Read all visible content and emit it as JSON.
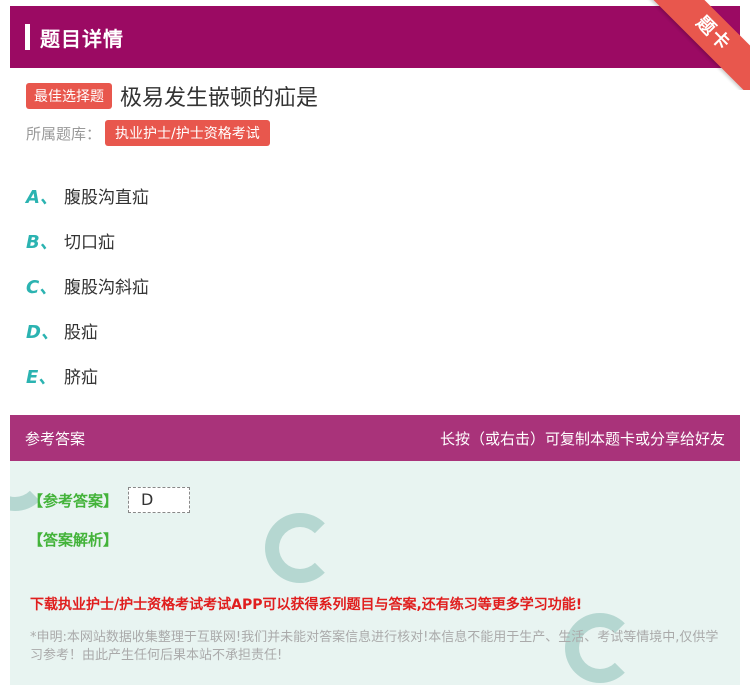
{
  "header": {
    "title": "题目详情",
    "ribbon": "题卡"
  },
  "question": {
    "badge": "最佳选择题",
    "text": "极易发生嵌顿的疝是"
  },
  "bank": {
    "label": "所属题库：",
    "tag": "执业护士/护士资格考试"
  },
  "options": [
    {
      "letter": "A、",
      "text": "腹股沟直疝"
    },
    {
      "letter": "B、",
      "text": "切口疝"
    },
    {
      "letter": "C、",
      "text": "腹股沟斜疝"
    },
    {
      "letter": "D、",
      "text": "股疝"
    },
    {
      "letter": "E、",
      "text": "脐疝"
    }
  ],
  "answer_head": {
    "left": "参考答案",
    "right": "长按（或右击）可复制本题卡或分享给好友"
  },
  "answer": {
    "ref_label": "【参考答案】",
    "ref_value": "D",
    "analysis_label": "【答案解析】",
    "promo": "下载执业护士/护士资格考试考试APP可以获得系列题目与答案,还有练习等更多学习功能!",
    "note": "*申明:本网站数据收集整理于互联网!我们并未能对答案信息进行核对!本信息不能用于生产、生活、考试等情境中,仅供学习参考！由此产生任何后果本站不承担责任!"
  },
  "colors": {
    "header": "#9b0a63",
    "answer_head": "#a9337a",
    "accent_red": "#e8574d",
    "option_letter": "#2bb3b1",
    "answer_green": "#43b33a"
  }
}
